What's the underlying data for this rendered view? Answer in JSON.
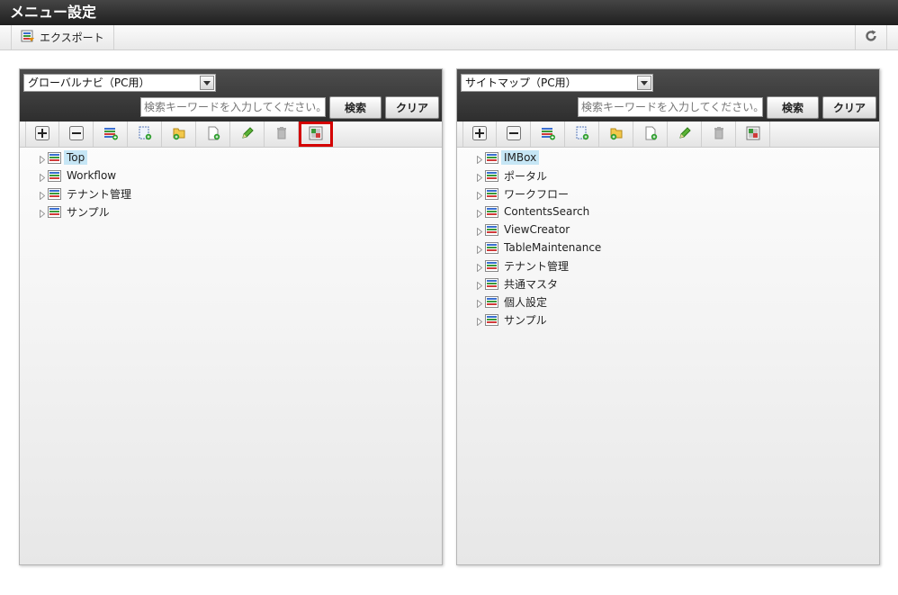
{
  "page": {
    "title": "メニュー設定"
  },
  "toolbar": {
    "export_label": "エクスポート"
  },
  "left_panel": {
    "selected": "グローバルナビ（PC用）",
    "search_placeholder": "検索キーワードを入力してください。",
    "search_label": "検索",
    "clear_label": "クリア",
    "items": [
      {
        "label": "Top",
        "selected": true
      },
      {
        "label": "Workflow",
        "selected": false
      },
      {
        "label": "テナント管理",
        "selected": false
      },
      {
        "label": "サンプル",
        "selected": false
      }
    ]
  },
  "right_panel": {
    "selected": "サイトマップ（PC用）",
    "search_placeholder": "検索キーワードを入力してください。",
    "search_label": "検索",
    "clear_label": "クリア",
    "items": [
      {
        "label": "IMBox",
        "selected": true
      },
      {
        "label": "ポータル",
        "selected": false
      },
      {
        "label": "ワークフロー",
        "selected": false
      },
      {
        "label": "ContentsSearch",
        "selected": false
      },
      {
        "label": "ViewCreator",
        "selected": false
      },
      {
        "label": "TableMaintenance",
        "selected": false
      },
      {
        "label": "テナント管理",
        "selected": false
      },
      {
        "label": "共通マスタ",
        "selected": false
      },
      {
        "label": "個人設定",
        "selected": false
      },
      {
        "label": "サンプル",
        "selected": false
      }
    ]
  },
  "tree_toolbar_icons": [
    "expand-all-icon",
    "collapse-all-icon",
    "add-menu-icon",
    "add-page-icon",
    "add-folder-icon",
    "add-file-icon",
    "edit-icon",
    "delete-icon",
    "import-icon"
  ],
  "highlighted_toolbar_icon": "import-icon",
  "colors": {
    "highlight": "#d40000",
    "selection": "#c6e6f5",
    "header": "#2e2e2e"
  }
}
